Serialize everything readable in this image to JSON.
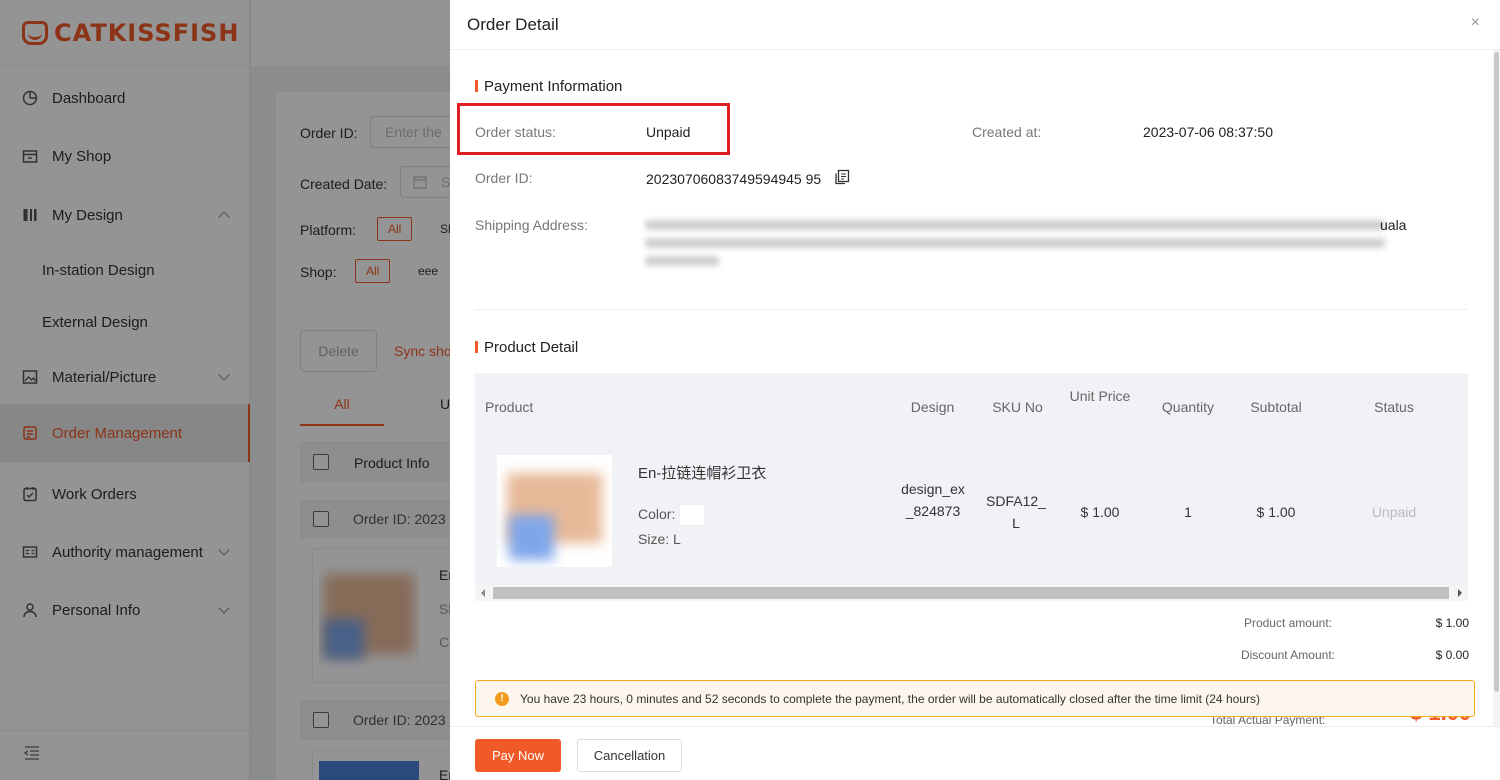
{
  "brand": {
    "name": "CATKISSFISH",
    "color": "#f05a28"
  },
  "sidebar": {
    "items": [
      {
        "label": "Dashboard",
        "icon": "pie-chart-icon"
      },
      {
        "label": "My Shop",
        "icon": "store-icon"
      },
      {
        "label": "My Design",
        "icon": "design-icon"
      },
      {
        "label": "In-station Design"
      },
      {
        "label": "External Design"
      },
      {
        "label": "Material/Picture",
        "icon": "image-icon"
      },
      {
        "label": "Order Management",
        "icon": "order-icon",
        "active": true
      },
      {
        "label": "Work Orders",
        "icon": "work-order-icon"
      },
      {
        "label": "Authority management",
        "icon": "id-card-icon"
      },
      {
        "label": "Personal Info",
        "icon": "user-icon"
      }
    ]
  },
  "filters": {
    "order_id_label": "Order ID:",
    "order_id_placeholder": "Enter the",
    "created_date_label": "Created Date:",
    "created_date_placeholder": "S",
    "platform_label": "Platform:",
    "platform_all": "All",
    "platform_next": "Sh",
    "shop_label": "Shop:",
    "shop_all": "All",
    "shop_next": "eee"
  },
  "actions": {
    "delete": "Delete",
    "sync": "Sync sho"
  },
  "tabs": {
    "all": "All",
    "next": "U"
  },
  "list": {
    "header": "Product Info",
    "order_prefix": "Order ID: 2023",
    "order_prefix_2": "Order ID: 2023",
    "row_texts": [
      "Er",
      "Sl",
      "Co"
    ],
    "row2_text": "Er"
  },
  "drawer": {
    "title": "Order Detail",
    "close": "×",
    "payment": {
      "section": "Payment Information",
      "status_label": "Order status:",
      "status_value": "Unpaid",
      "created_label": "Created at:",
      "created_value": "2023-07-06 08:37:50",
      "order_id_label": "Order ID:",
      "order_id_value": "20230706083749594945 95",
      "address_label": "Shipping Address:",
      "address_tail": "uala"
    },
    "product": {
      "section": "Product Detail",
      "columns": [
        "Product",
        "Design",
        "SKU No",
        "Unit Price",
        "Quantity",
        "Subtotal",
        "Status"
      ],
      "name": "En-拉链连帽衫卫衣",
      "color_label": "Color:",
      "size_label": "Size: L",
      "design": "design_ex_824873",
      "sku": "SDFA12_L",
      "unit_price": "$ 1.00",
      "quantity": "1",
      "subtotal": "$ 1.00",
      "status": "Unpaid"
    },
    "summary": {
      "product_amount_label": "Product amount:",
      "product_amount": "$ 1.00",
      "discount_label": "Discount Amount:",
      "discount": "$ 0.00",
      "total_label": "Total Actual Payment:",
      "total": "$ 1.00"
    },
    "notice": "You have 23 hours, 0 minutes and 52 seconds to complete the payment, the order will be automatically closed after the time limit (24 hours)",
    "pay_now": "Pay Now",
    "cancellation": "Cancellation"
  }
}
